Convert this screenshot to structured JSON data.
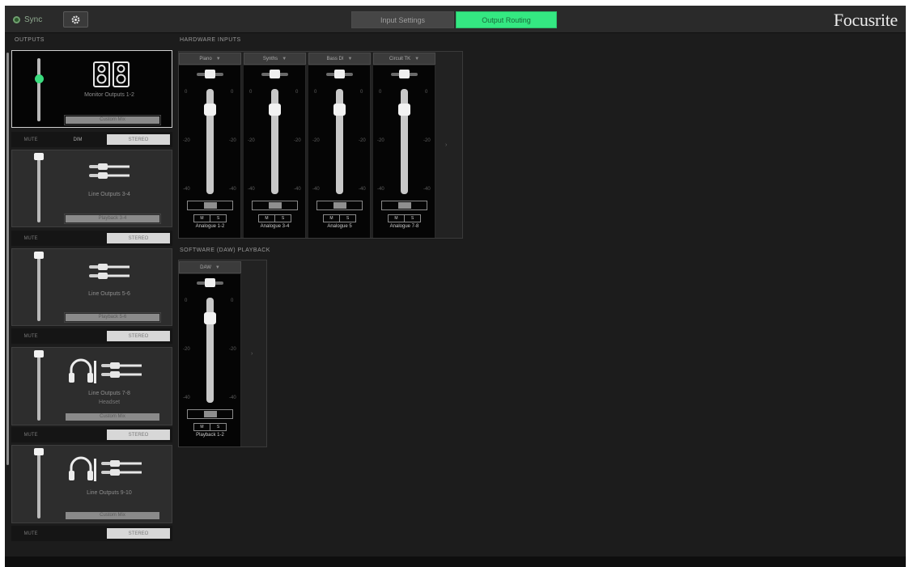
{
  "topbar": {
    "sync_label": "Sync",
    "tabs": [
      {
        "label": "Input Settings",
        "active": false
      },
      {
        "label": "Output Routing",
        "active": true
      }
    ],
    "brand": "Focusrite"
  },
  "sections": {
    "outputs": "OUTPUTS",
    "hardware_inputs": "HARDWARE INPUTS",
    "software_playback": "SOFTWARE (DAW) PLAYBACK"
  },
  "outputs": [
    {
      "name": "Monitor Outputs 1-2",
      "sub": "",
      "source": "Custom Mix",
      "icon": "speakers-icon",
      "selected": true,
      "footer": {
        "mute": "MUTE",
        "dim": "DIM",
        "mode": "STEREO"
      }
    },
    {
      "name": "Line Outputs 3-4",
      "sub": "",
      "source": "Playback 3-4",
      "icon": "line-cables-icon",
      "selected": false,
      "footer": {
        "mute": "MUTE",
        "dim": "",
        "mode": "STEREO"
      }
    },
    {
      "name": "Line Outputs 5-6",
      "sub": "",
      "source": "Playback 5-6",
      "icon": "line-cables-icon",
      "selected": false,
      "footer": {
        "mute": "MUTE",
        "dim": "",
        "mode": "STEREO"
      }
    },
    {
      "name": "Line Outputs 7-8",
      "sub": "Headset",
      "source": "Custom Mix",
      "icon": "headphones-cables-icon",
      "selected": false,
      "footer": {
        "mute": "MUTE",
        "dim": "",
        "mode": "STEREO"
      }
    },
    {
      "name": "Line Outputs 9-10",
      "sub": "",
      "source": "Custom Mix",
      "icon": "headphones-cables-icon",
      "selected": false,
      "footer": {
        "mute": "MUTE",
        "dim": "",
        "mode": "STEREO"
      }
    }
  ],
  "hardware_strips": [
    {
      "head": "Piano",
      "label": "Analogue 1-2",
      "mute": "M",
      "solo": "S"
    },
    {
      "head": "Synths",
      "label": "Analogue 3-4",
      "mute": "M",
      "solo": "S"
    },
    {
      "head": "Bass DI",
      "label": "Analogue 5",
      "mute": "M",
      "solo": "S"
    },
    {
      "head": "Circuit TK",
      "label": "Analogue 7-8",
      "mute": "M",
      "solo": "S"
    }
  ],
  "software_strips": [
    {
      "head": "DAW",
      "label": "Playback 1-2",
      "mute": "M",
      "solo": "S"
    }
  ],
  "scale_ticks": {
    "top": "0",
    "mid": "-20",
    "low": "-40"
  }
}
